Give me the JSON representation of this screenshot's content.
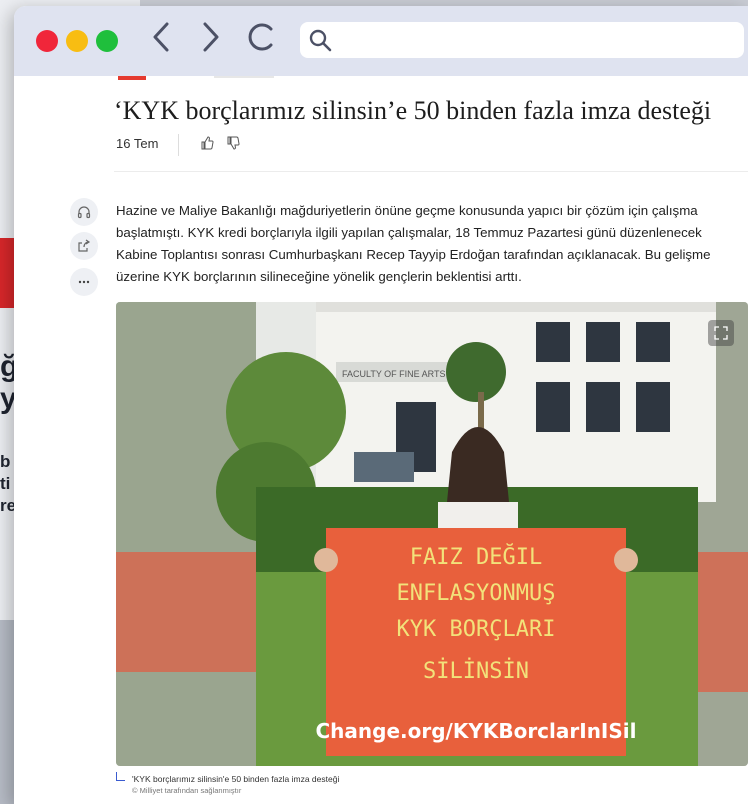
{
  "browser": {
    "back_icon": "chevron-left-icon",
    "forward_icon": "chevron-right-icon",
    "reload_icon": "reload-icon",
    "search_icon": "search-icon",
    "url_value": "",
    "url_placeholder": ""
  },
  "background_page": {
    "headline_fragment_1": "ğ",
    "headline_fragment_2": "y",
    "text_fragment_1": "b",
    "text_fragment_2": "ti",
    "text_fragment_3": "re"
  },
  "article": {
    "title": "‘KYK borçlarımız silinsin’e 50 binden fazla imza desteği",
    "date": "16 Tem",
    "body": "Hazine ve Maliye Bakanlığı mağduriyetlerin önüne geçme konusunda yapıcı bir çözüm için çalışma başlatmıştı. KYK kredi borçlarıyla ilgili yapılan çalışmalar, 18 Temmuz Pazartesi günü düzenlenecek Kabine Toplantısı sonrası Cumhurbaşkanı Recep Tayyip Erdoğan tarafından açıklanacak. Bu gelişme üzerine KYK borçlarının silineceğine yönelik gençlerin beklentisi arttı.",
    "caption": "'KYK borçlarımız silinsin'e 50 binden fazla imza desteği",
    "credit": "© Milliyet tarafından sağlanmıştır"
  },
  "photo": {
    "building_sign": "FACULTY OF FINE ARTS",
    "sign_line_1": "FAIZ DEĞIL",
    "sign_line_2": "ENFLASYONMUŞ",
    "sign_line_3": "KYK BORÇLARI",
    "sign_line_4": "SİLİNSİN",
    "sign_line_5": "Change.org/KYKBorclarInISil"
  },
  "colors": {
    "accent_red": "#e53a2f",
    "sign_orange": "#e8603c",
    "sign_text": "#f2e27a",
    "chrome_bg": "#dfe3f0"
  }
}
